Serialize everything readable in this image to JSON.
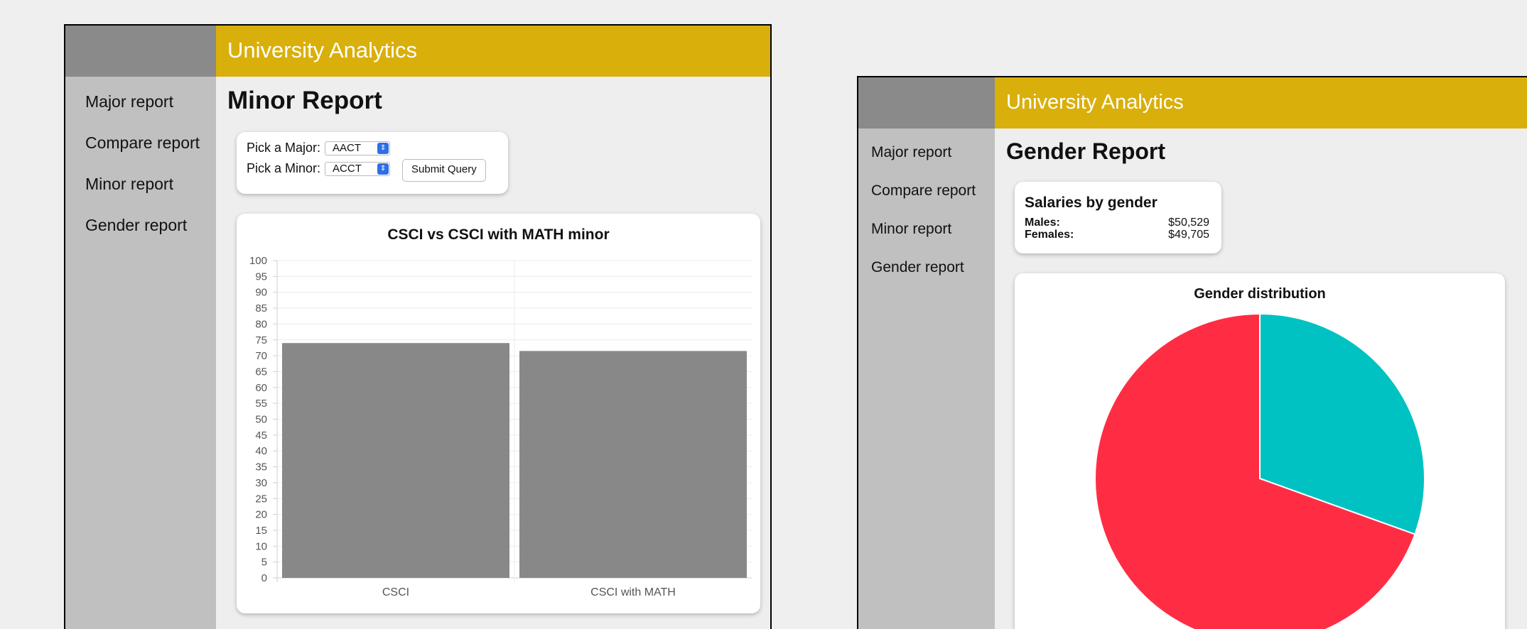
{
  "app": {
    "title": "University Analytics"
  },
  "nav": [
    "Major report",
    "Compare report",
    "Minor report",
    "Gender report"
  ],
  "minor_report": {
    "page_title": "Minor Report",
    "form": {
      "major_label": "Pick a Major:",
      "major_value": "AACT",
      "minor_label": "Pick a Minor:",
      "minor_value": "ACCT",
      "submit_label": "Submit Query"
    }
  },
  "gender_report": {
    "page_title": "Gender Report",
    "salaries": {
      "title": "Salaries by gender",
      "rows": [
        {
          "label": "Males:",
          "value": "$50,529"
        },
        {
          "label": "Females:",
          "value": "$49,705"
        }
      ]
    }
  },
  "chart_data": [
    {
      "type": "bar",
      "title": "CSCI vs CSCI with MATH minor",
      "categories": [
        "CSCI",
        "CSCI with MATH"
      ],
      "values": [
        74,
        71.5
      ],
      "ylim": [
        0,
        100
      ],
      "ytick_step": 5,
      "xlabel": "",
      "ylabel": "",
      "grid": true,
      "bar_color": "#888888"
    },
    {
      "type": "pie",
      "title": "Gender distribution",
      "slices": [
        {
          "value": 30.5,
          "color": "#00c2c2"
        },
        {
          "value": 69.5,
          "color": "#ff2d44"
        }
      ]
    }
  ]
}
